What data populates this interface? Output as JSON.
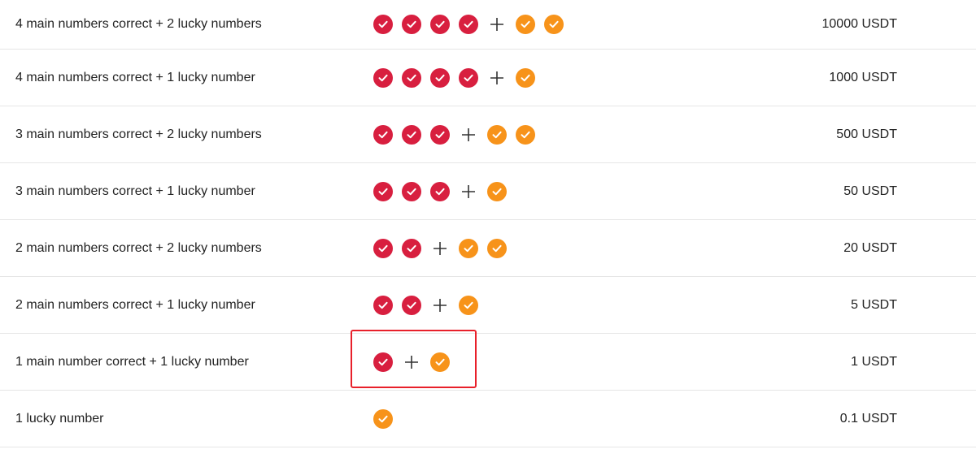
{
  "prize_table": {
    "rows": [
      {
        "condition": "4 main numbers correct + 2 lucky numbers",
        "main": 4,
        "lucky": 2,
        "prize": "10000 USDT"
      },
      {
        "condition": "4 main numbers correct + 1 lucky number",
        "main": 4,
        "lucky": 1,
        "prize": "1000 USDT"
      },
      {
        "condition": "3 main numbers correct + 2 lucky numbers",
        "main": 3,
        "lucky": 2,
        "prize": "500 USDT"
      },
      {
        "condition": "3 main numbers correct + 1 lucky number",
        "main": 3,
        "lucky": 1,
        "prize": "50 USDT"
      },
      {
        "condition": "2 main numbers correct + 2 lucky numbers",
        "main": 2,
        "lucky": 2,
        "prize": "20 USDT"
      },
      {
        "condition": "2 main numbers correct + 1 lucky number",
        "main": 2,
        "lucky": 1,
        "prize": "5 USDT"
      },
      {
        "condition": "1 main number correct + 1 lucky number",
        "main": 1,
        "lucky": 1,
        "prize": "1 USDT"
      },
      {
        "condition": "1 lucky number",
        "main": 0,
        "lucky": 1,
        "prize": "0.1 USDT"
      }
    ],
    "highlighted_row": 6
  },
  "colors": {
    "main_check": "#d81f3f",
    "lucky_check": "#f7931a",
    "highlight_border": "#e8202a"
  },
  "icons": {
    "main": "check-circle-icon",
    "lucky": "check-circle-icon",
    "plus": "plus-icon"
  }
}
